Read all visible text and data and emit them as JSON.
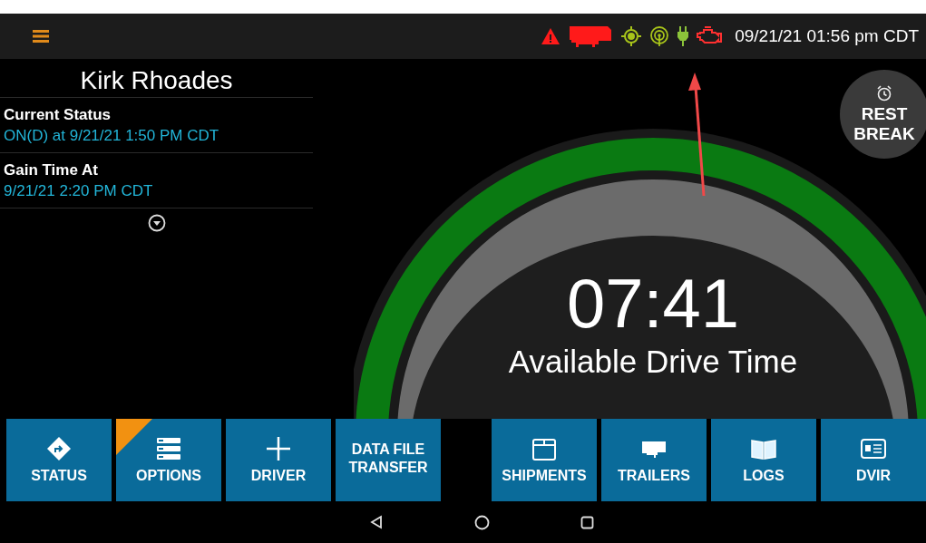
{
  "top_bar": {
    "status_icons": [
      {
        "kind": "warning",
        "color": "#ff1a1a"
      },
      {
        "kind": "truck",
        "color": "#ff1a1a"
      },
      {
        "kind": "gps",
        "color": "#a8c41a"
      },
      {
        "kind": "signal",
        "color": "#a8c41a"
      },
      {
        "kind": "plug",
        "color": "#8cc43a"
      },
      {
        "kind": "engine",
        "color": "#ff3030"
      }
    ],
    "datetime": "09/21/21 01:56 pm CDT"
  },
  "driver_panel": {
    "name": "Kirk Rhoades",
    "fields": [
      {
        "label": "Current Status",
        "value": "ON(D) at 9/21/21 1:50 PM CDT"
      },
      {
        "label": "Gain Time At",
        "value": "9/21/21 2:20 PM CDT"
      }
    ],
    "expanded": false
  },
  "rest_break": {
    "label_line_1": "REST",
    "label_line_2": "BREAK"
  },
  "gauge": {
    "time": "07:41",
    "caption": "Available Drive Time"
  },
  "buttons": [
    {
      "kind": "status",
      "label": "STATUS",
      "flagged": false
    },
    {
      "kind": "options",
      "label": "OPTIONS",
      "flagged": true
    },
    {
      "kind": "driver",
      "label": "DRIVER",
      "flagged": false
    },
    {
      "kind": "transfer",
      "label": "DATA FILE TRANSFER",
      "flagged": false
    },
    {
      "kind": "gap"
    },
    {
      "kind": "shipments",
      "label": "SHIPMENTS",
      "flagged": false
    },
    {
      "kind": "trailers",
      "label": "TRAILERS",
      "flagged": false
    },
    {
      "kind": "logs",
      "label": "LOGS",
      "flagged": false
    },
    {
      "kind": "dvir",
      "label": "DVIR",
      "flagged": false
    }
  ]
}
